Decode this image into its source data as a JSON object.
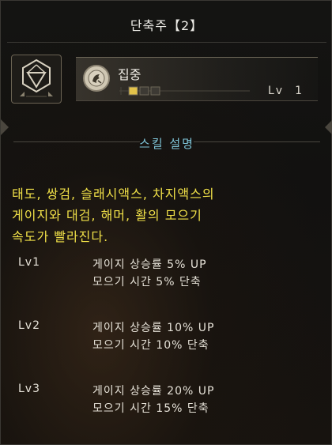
{
  "header": {
    "title": "단축주【2】"
  },
  "jewel": {
    "icon": "diamond-jewel-icon",
    "frame_color": "#6b6353"
  },
  "skill": {
    "name": "집중",
    "icon": "skill-emblem-icon",
    "level_label": "Lv",
    "level_value": "1",
    "level_filled": 1,
    "level_max": 3,
    "level_color": "#e2c24a"
  },
  "section": {
    "title": "스킬 설명",
    "title_color": "#7fc6d9"
  },
  "description": {
    "lines": [
      "태도, 쌍검, 슬래시액스, 차지액스의",
      "게이지와 대검, 해머, 활의 모으기",
      "속도가 빨라진다."
    ],
    "color": "#f0e048"
  },
  "levels": [
    {
      "label": "Lv1",
      "line1": "게이지 상승률 5% UP",
      "line2": "모으기 시간 5% 단축"
    },
    {
      "label": "Lv2",
      "line1": "게이지 상승률 10% UP",
      "line2": "모으기 시간 10% 단축"
    },
    {
      "label": "Lv3",
      "line1": "게이지 상승률 20% UP",
      "line2": "모으기 시간 15% 단축"
    }
  ]
}
